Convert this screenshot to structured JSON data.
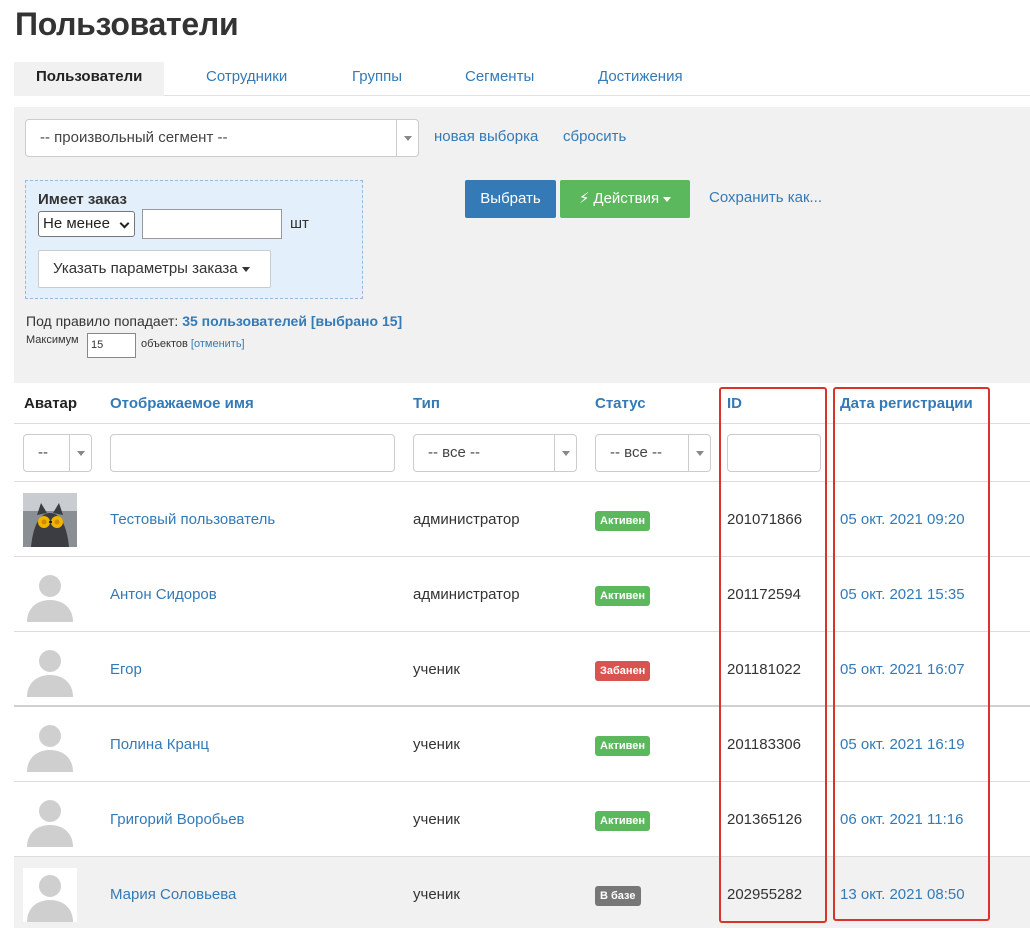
{
  "page": {
    "title": "Пользователи"
  },
  "tabs": [
    {
      "label": "Пользователи",
      "active": true
    },
    {
      "label": "Сотрудники"
    },
    {
      "label": "Группы"
    },
    {
      "label": "Сегменты"
    },
    {
      "label": "Достижения"
    }
  ],
  "filter": {
    "segment_value": "-- произвольный сегмент --",
    "new_selection": "новая выборка",
    "reset": "сбросить",
    "rule": {
      "title": "Имеет заказ",
      "operator": "Не менее",
      "count_value": "",
      "unit": "шт",
      "order_params_label": "Указать параметры заказа"
    },
    "select_button": "Выбрать",
    "actions_button": "Действия",
    "save_as": "Сохранить как...",
    "summary_prefix": "Под правило попадает:",
    "summary_value": "35 пользователей [выбрано 15]",
    "max_label": "Максимум",
    "max_value": "15",
    "objects_label": "объектов",
    "cancel_link": "[отменить]"
  },
  "table": {
    "columns": {
      "avatar": "Аватар",
      "name": "Отображаемое имя",
      "type": "Тип",
      "status": "Статус",
      "id": "ID",
      "date": "Дата регистрации"
    },
    "filters": {
      "avatar": "--",
      "type": "-- все --",
      "status": "-- все --"
    },
    "rows": [
      {
        "avatar": "photo",
        "name": "Тестовый пользователь",
        "type": "администратор",
        "status": "Активен",
        "status_color": "#5cb85c",
        "id": "201071866",
        "date": "05 окт. 2021 09:20"
      },
      {
        "avatar": "placeholder",
        "name": "Антон Сидоров",
        "type": "администратор",
        "status": "Активен",
        "status_color": "#5cb85c",
        "id": "201172594",
        "date": "05 окт. 2021 15:35"
      },
      {
        "avatar": "placeholder",
        "name": "Егор",
        "type": "ученик",
        "status": "Забанен",
        "status_color": "#d9534f",
        "id": "201181022",
        "date": "05 окт. 2021 16:07"
      },
      {
        "avatar": "placeholder",
        "name": "Полина Кранц",
        "type": "ученик",
        "status": "Активен",
        "status_color": "#5cb85c",
        "id": "201183306",
        "date": "05 окт. 2021 16:19"
      },
      {
        "avatar": "placeholder",
        "name": "Григорий Воробьев",
        "type": "ученик",
        "status": "Активен",
        "status_color": "#5cb85c",
        "id": "201365126",
        "date": "06 окт. 2021 11:16"
      },
      {
        "avatar": "placeholder",
        "name": "Мария Соловьева",
        "type": "ученик",
        "status": "В базе",
        "status_color": "#777777",
        "id": "202955282",
        "date": "13 окт. 2021 08:50"
      }
    ]
  },
  "colors": {
    "link": "#337ab7",
    "primary": "#337ab7",
    "success": "#5cb85c",
    "danger": "#d9534f",
    "highlight": "#d9342b"
  }
}
